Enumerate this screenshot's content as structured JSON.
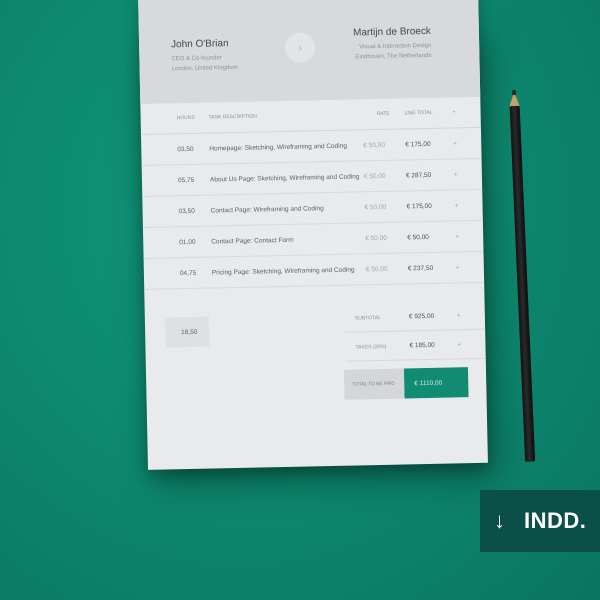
{
  "invoice": {
    "from": {
      "name": "John O'Brian",
      "line1": "CEO & Co-founder",
      "line2": "London, United Kingdom"
    },
    "to": {
      "name": "Martijn de Broeck",
      "line1": "Visual & Interaction Design",
      "line2": "Eindhoven, The Netherlands"
    },
    "columns": {
      "hours": "HOURS",
      "description": "TASK DESCRIPTION",
      "rate": "RATE",
      "total": "LINE TOTAL",
      "plus": "+"
    },
    "items": [
      {
        "hours": "03,50",
        "description": "Homepage: Sketching, Wireframing and Coding",
        "rate": "€ 50,00",
        "total": "€ 175,00",
        "plus": "+"
      },
      {
        "hours": "05,75",
        "description": "About Us Page: Sketching, Wireframing and Coding",
        "rate": "€ 50,00",
        "total": "€ 287,50",
        "plus": "+"
      },
      {
        "hours": "03,50",
        "description": "Contact Page: Wireframing and Coding",
        "rate": "€ 50,00",
        "total": "€ 175,00",
        "plus": "+"
      },
      {
        "hours": "01,00",
        "description": "Contact Page: Contact Form",
        "rate": "€ 50,00",
        "total": "€ 50,00",
        "plus": "+"
      },
      {
        "hours": "04,75",
        "description": "Pricing Page: Sketching, Wireframing and Coding",
        "rate": "€ 50,00",
        "total": "€ 237,50",
        "plus": "+"
      }
    ],
    "hours_total": "18,50",
    "subtotal": {
      "label": "SUBTOTAL",
      "value": "€ 925,00",
      "plus": "+"
    },
    "taxes": {
      "label": "TAXES (20%)",
      "value": "€ 185,00",
      "plus": "+"
    },
    "grand": {
      "label": "TOTAL TO BE PAID",
      "value": "€ 1110,00"
    }
  },
  "badge": {
    "arrow": "↓",
    "label": "INDD."
  },
  "icons": {
    "header_arrow": "chevron-right-icon",
    "badge_arrow": "download-arrow-icon"
  },
  "colors": {
    "background": "#0e8a70",
    "accent": "#128b73",
    "badge": "#0b4f48",
    "paper": "#e9eaeb"
  }
}
